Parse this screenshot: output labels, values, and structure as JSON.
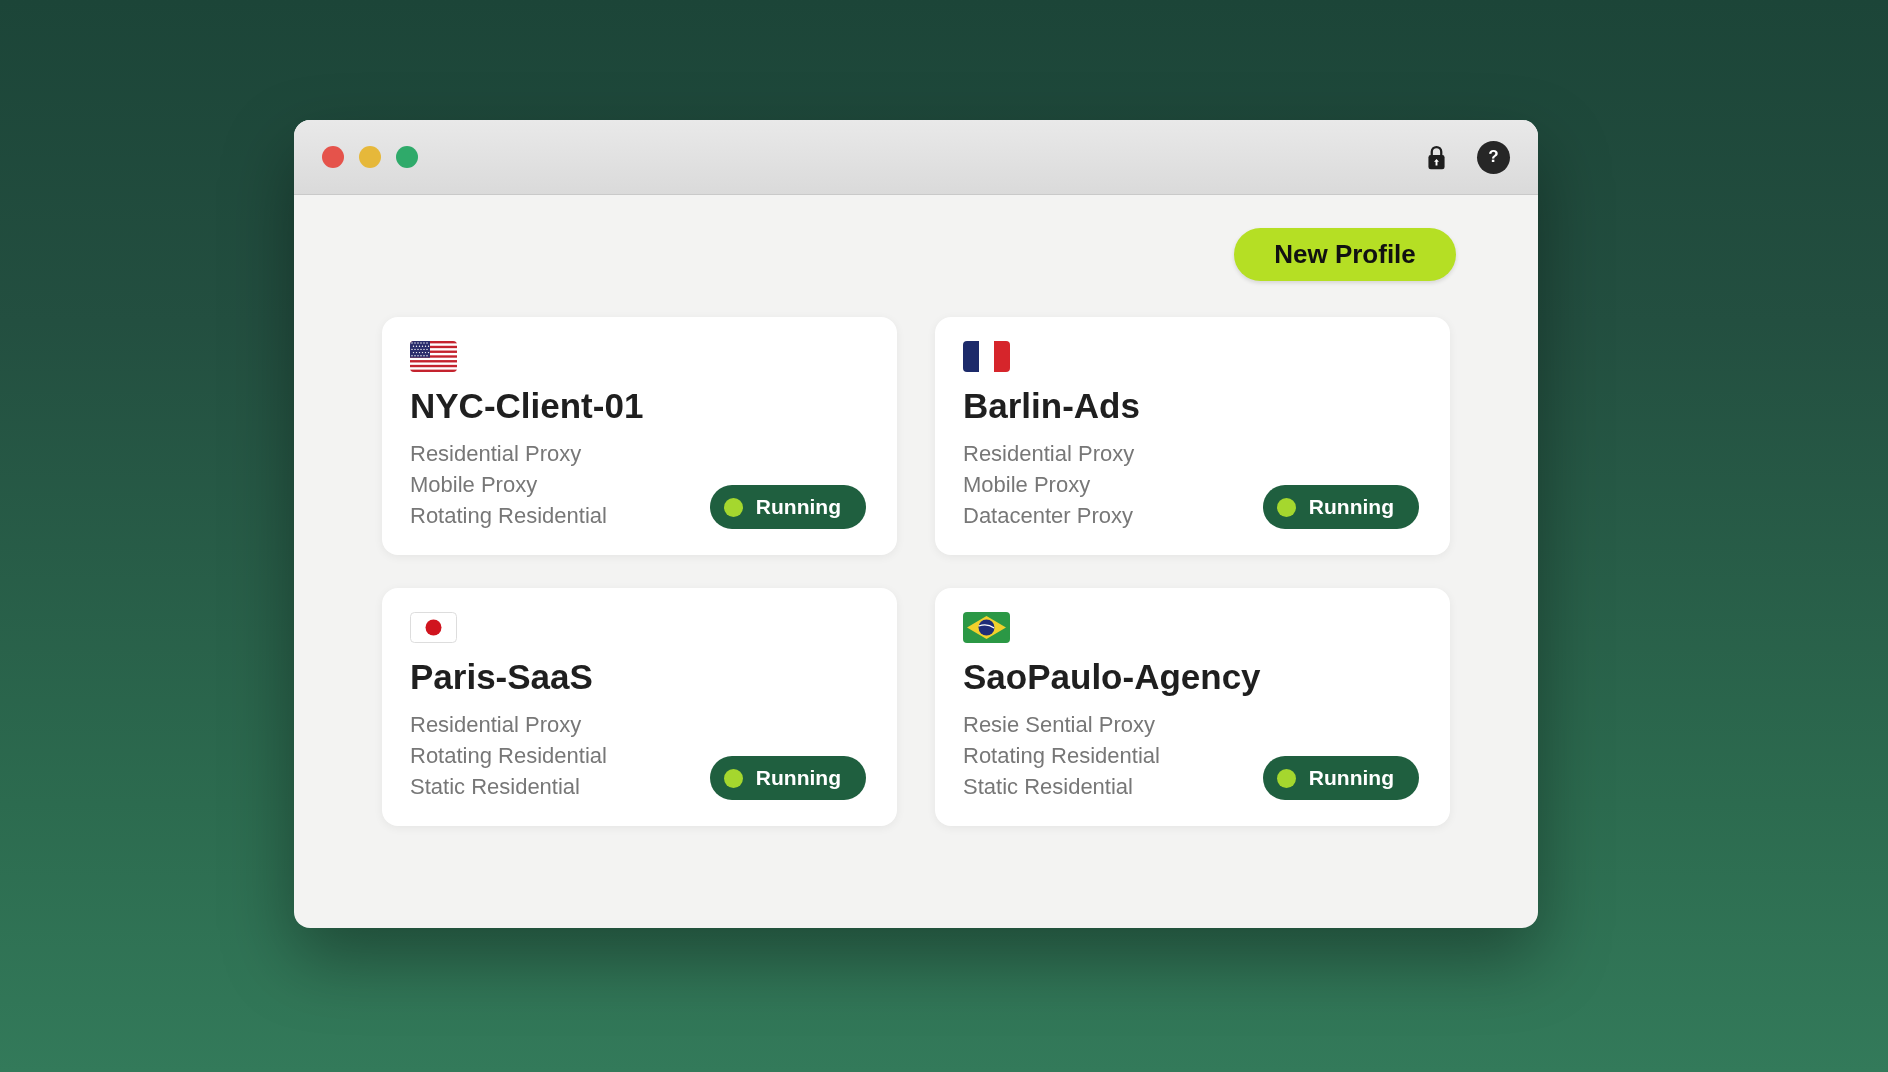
{
  "toolbar": {
    "help_label": "?"
  },
  "new_profile_button": {
    "label": "New Profile"
  },
  "profiles": [
    {
      "flag": {
        "kind": "us"
      },
      "name": "NYC-Client-01",
      "proxy_types": [
        "Residential Proxy",
        "Mobile Proxy",
        "Rotating Residential"
      ],
      "status": {
        "label": "Running"
      }
    },
    {
      "flag": {
        "kind": "fr"
      },
      "name": "Barlin-Ads",
      "proxy_types": [
        "Residential Proxy",
        "Mobile Proxy",
        "Datacenter Proxy"
      ],
      "status": {
        "label": "Running"
      }
    },
    {
      "flag": {
        "kind": "jp"
      },
      "name": "Paris-SaaS",
      "proxy_types": [
        "Residential Proxy",
        "Rotating Residential",
        "Static Residential"
      ],
      "status": {
        "label": "Running"
      }
    },
    {
      "flag": {
        "kind": "br"
      },
      "name": "SaoPaulo-Agency",
      "proxy_types": [
        "Resie Sential Proxy",
        "Rotating Residential",
        "Static Residential"
      ],
      "status": {
        "label": "Running"
      }
    }
  ]
}
